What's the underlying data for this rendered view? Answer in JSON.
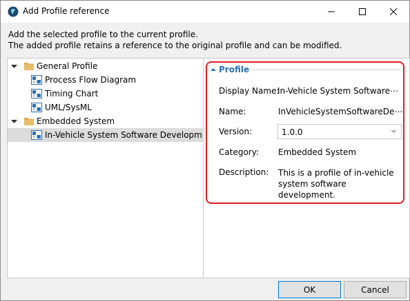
{
  "window": {
    "title": "Add Profile reference",
    "controls": [
      "minimize",
      "maximize",
      "close"
    ]
  },
  "description": {
    "line1": "Add the selected profile to the current profile.",
    "line2": "The added profile retains a reference to the original profile and can be modified."
  },
  "tree": [
    {
      "label": "General Profile",
      "type": "folder",
      "expanded": true,
      "selected": false
    },
    {
      "label": "Process Flow Diagram",
      "type": "profile",
      "selected": false
    },
    {
      "label": "Timing Chart",
      "type": "profile",
      "selected": false
    },
    {
      "label": "UML/SysML",
      "type": "profile",
      "selected": false
    },
    {
      "label": "Embedded System",
      "type": "folder",
      "expanded": true,
      "selected": false
    },
    {
      "label": "In-Vehicle System Software Developm",
      "type": "profile",
      "selected": true
    }
  ],
  "profile": {
    "section_title": "Profile",
    "display_name_label": "Display Name:",
    "display_name_value": "In-Vehicle System Software⋯",
    "name_label": "Name:",
    "name_value": "InVehicleSystemSoftwareDe⋯",
    "version_label": "Version:",
    "version_value": "1.0.0",
    "category_label": "Category:",
    "category_value": "Embedded System",
    "description_label": "Description:",
    "description_value": "This is a profile of in-vehicle system software development."
  },
  "buttons": {
    "ok": "OK",
    "cancel": "Cancel"
  },
  "colors": {
    "highlight": "#e01e1e",
    "section_title": "#2a6fb4",
    "selection": "#dcdcdc"
  }
}
